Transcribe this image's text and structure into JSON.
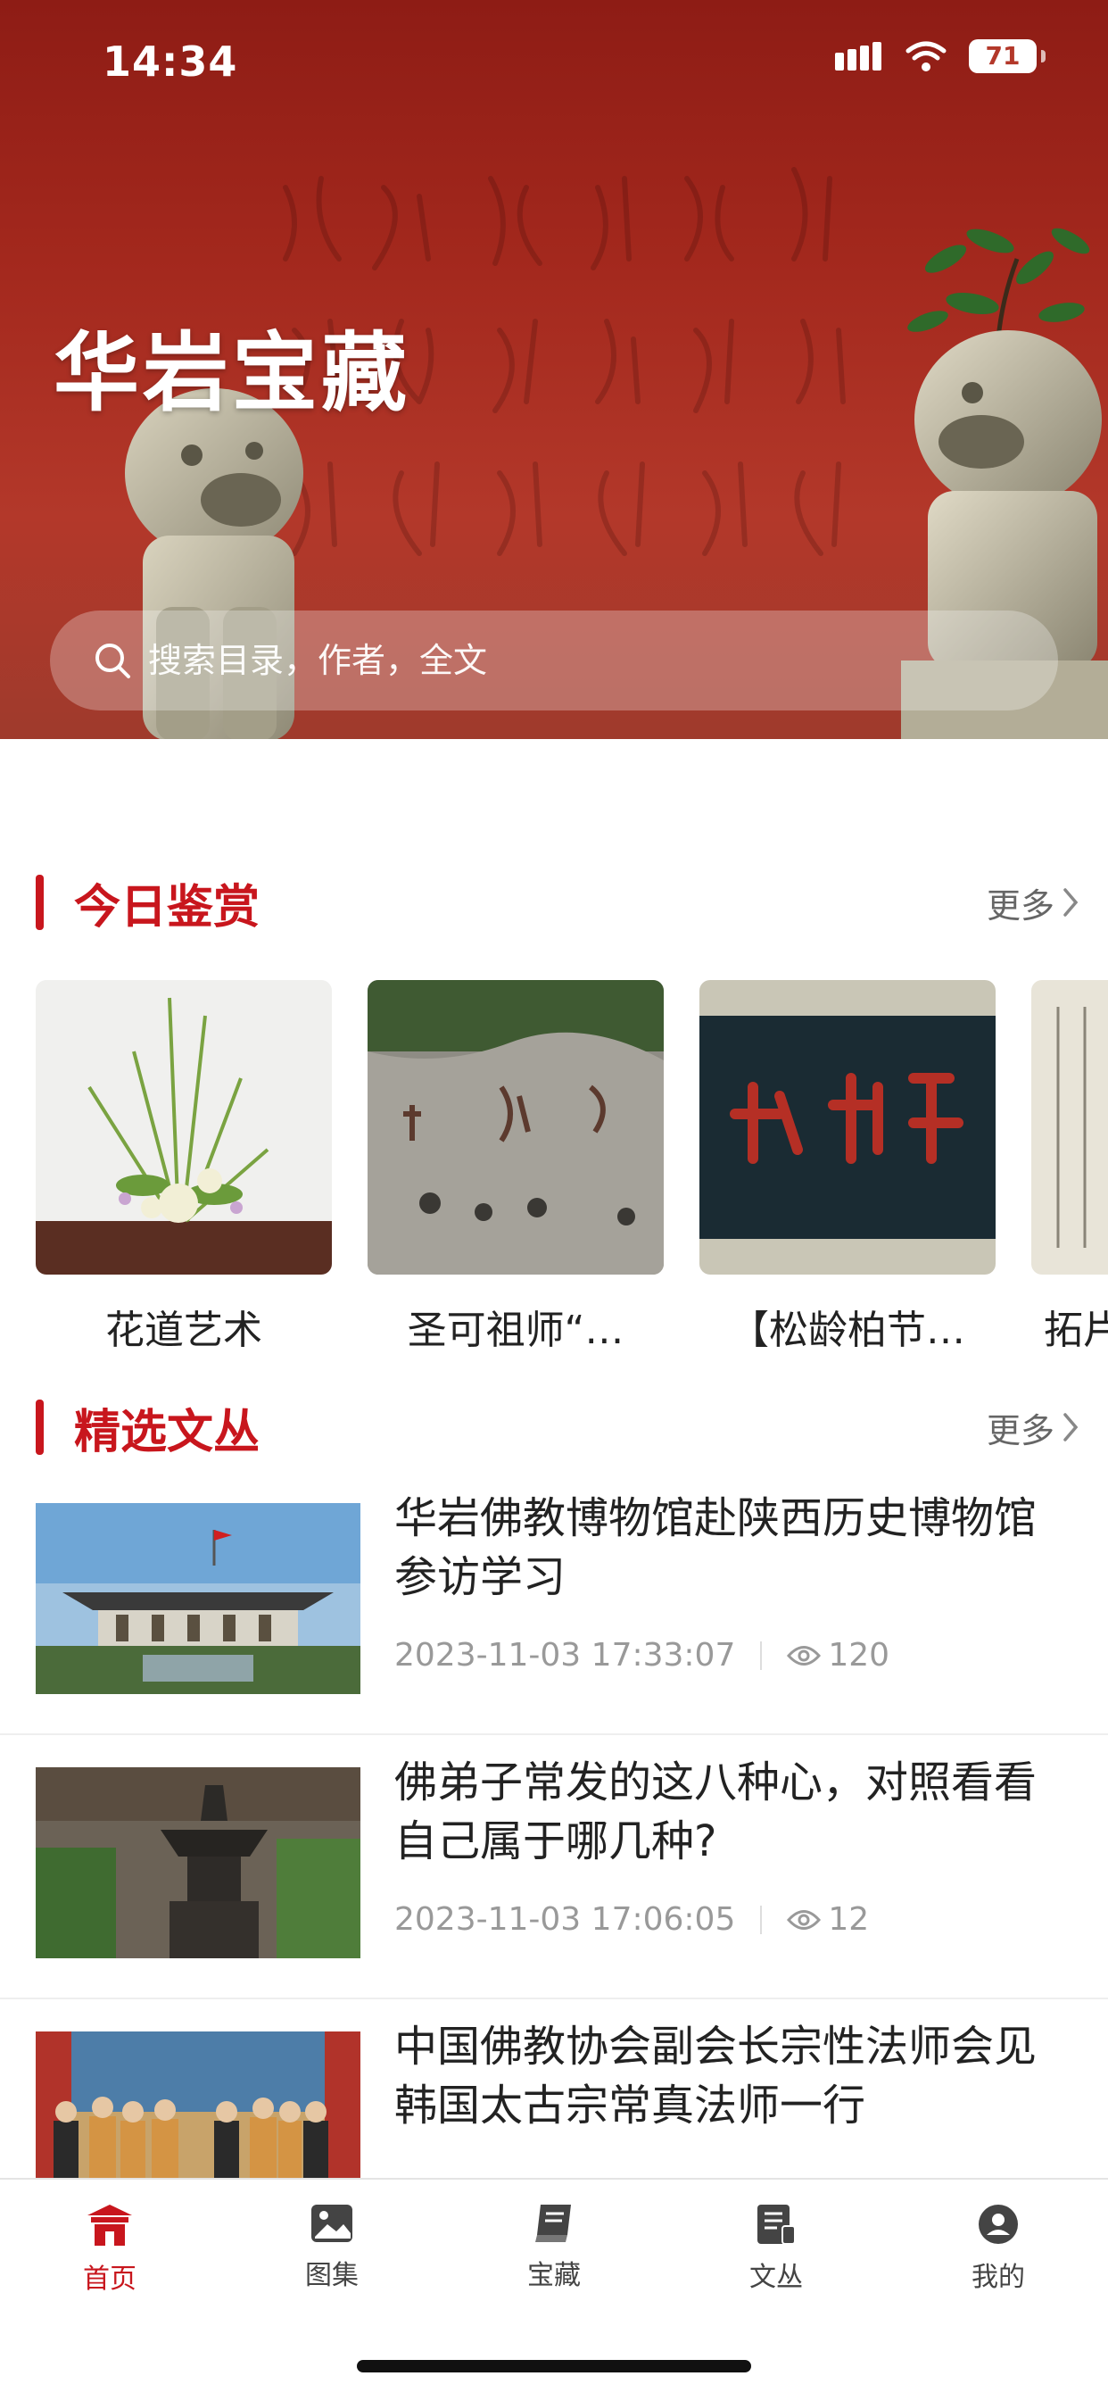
{
  "status_bar": {
    "time": "14:34",
    "battery": "71"
  },
  "hero": {
    "title": "华岩宝藏",
    "search_placeholder": "搜索目录，作者，全文"
  },
  "today_section": {
    "title": "今日鉴赏",
    "more": "更多",
    "items": [
      {
        "caption": "花道艺术"
      },
      {
        "caption": "圣可祖师“…"
      },
      {
        "caption": "【松龄柏节…"
      },
      {
        "caption": "拓片"
      }
    ]
  },
  "articles_section": {
    "title": "精选文丛",
    "more": "更多",
    "items": [
      {
        "title": "华岩佛教博物馆赴陕西历史博物馆参访学习",
        "date": "2023-11-03 17:33:07",
        "views": "120"
      },
      {
        "title": "佛弟子常发的这八种心，对照看看自己属于哪几种?",
        "date": "2023-11-03 17:06:05",
        "views": "12"
      },
      {
        "title": "中国佛教协会副会长宗性法师会见韩国太古宗常真法师一行",
        "date": "",
        "views": ""
      }
    ]
  },
  "tab_bar": {
    "tabs": [
      {
        "label": "首页",
        "icon": "temple-icon",
        "active": true
      },
      {
        "label": "图集",
        "icon": "image-icon",
        "active": false
      },
      {
        "label": "宝藏",
        "icon": "book-icon",
        "active": false
      },
      {
        "label": "文丛",
        "icon": "document-icon",
        "active": false
      },
      {
        "label": "我的",
        "icon": "user-icon",
        "active": false
      }
    ]
  },
  "colors": {
    "accent": "#c8161d",
    "hero_bg": "#a3281d"
  }
}
